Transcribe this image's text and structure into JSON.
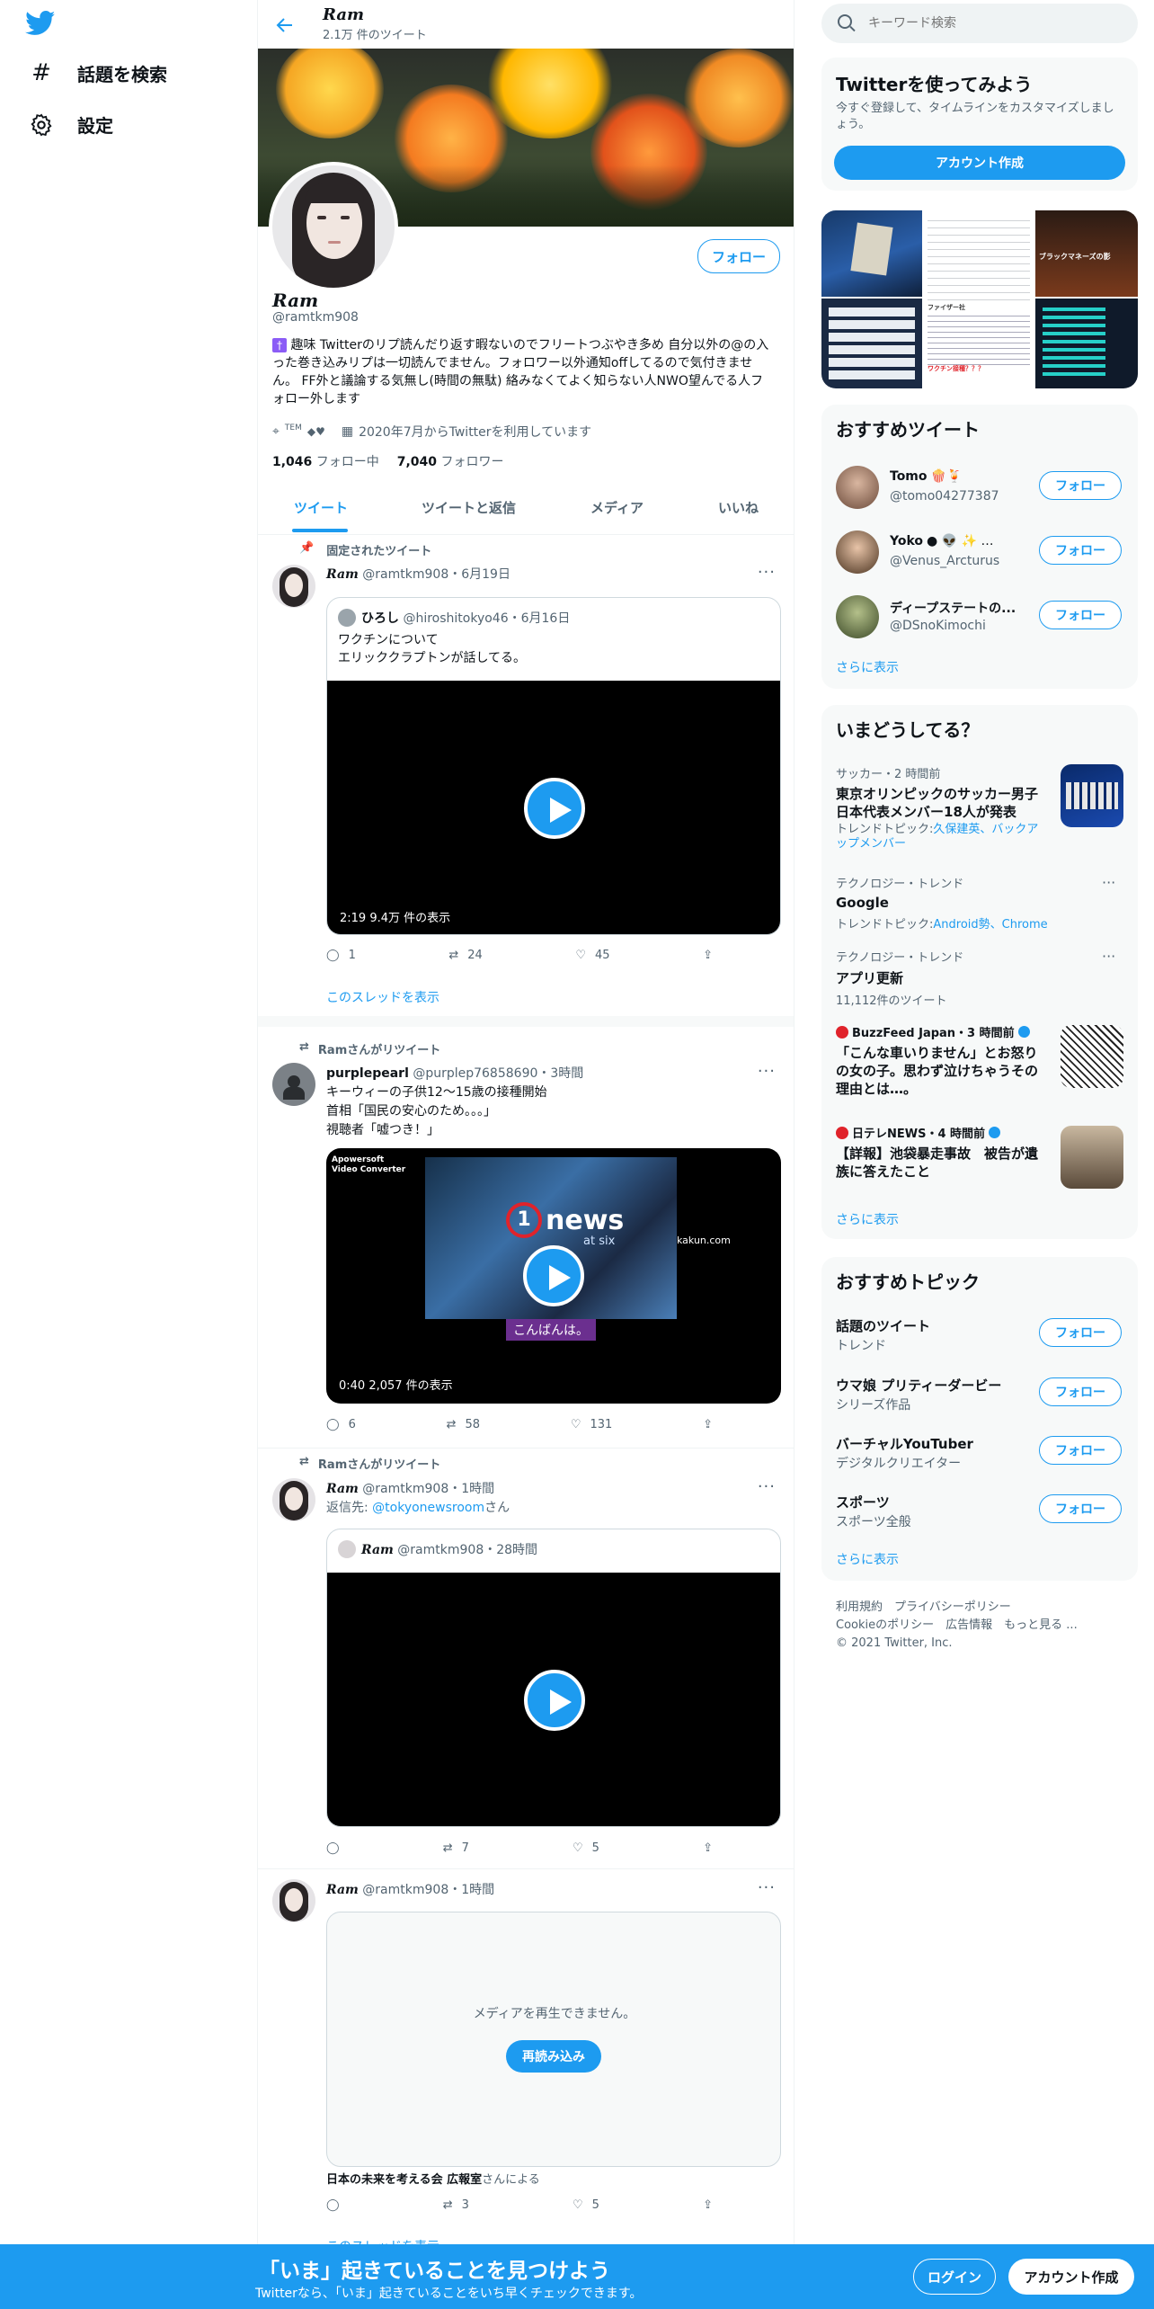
{
  "nav": {
    "search": "話題を検索",
    "settings": "設定"
  },
  "header": {
    "name": "Ram",
    "count": "2.1万 件のツイート"
  },
  "profile": {
    "name": "Ram",
    "handle": "@ramtkm908",
    "follow": "フォロー",
    "bio": "趣味 Twitterのリプ読んだり返す暇ないのでフリートつぶやき多め 自分以外の@の入った巻き込みリプは一切読んでません。フォロワー以外通知offしてるので気付きません。 FF外と議論する気無し(時間の無駄) 絡みなくてよく知らない人NWO望んでる人フォロー外します",
    "location": "TEM",
    "joined": "2020年7月からTwitterを利用しています",
    "following_n": "1,046",
    "following": "フォロー中",
    "followers_n": "7,040",
    "followers": "フォロワー"
  },
  "tabs": [
    "ツイート",
    "ツイートと返信",
    "メディア",
    "いいね"
  ],
  "t1": {
    "pinned": "固定されたツイート",
    "name": "Ram",
    "meta": "@ramtkm908・6月19日",
    "qname": "ひろし",
    "qmeta": "@hiroshitokyo46・6月16日",
    "qtext1": "ワクチンについて",
    "qtext2": "エリッククラプトンが話してる。",
    "vlabel": "2:19 9.4万 件の表示",
    "reply": "1",
    "rt": "24",
    "like": "45",
    "thread": "このスレッドを表示"
  },
  "t2": {
    "rtby": "Ramさんがリツイート",
    "name": "purplepearl",
    "meta": "@purplep76858690・3時間",
    "line1": "キーウィーの子供12～15歳の接種開始",
    "line2": "首相「国民の安心のため。。。」",
    "line3": "視聴者「嘘つき！」",
    "wm1": "Apowersoft",
    "wm2": "Video Converter",
    "news": "news",
    "newssub": "at six",
    "site": "kakun.com",
    "caption": "こんばんは。",
    "vlabel": "0:40 2,057 件の表示",
    "reply": "6",
    "rt": "58",
    "like": "131"
  },
  "t3": {
    "rtby": "Ramさんがリツイート",
    "name": "Ram",
    "meta": "@ramtkm908・1時間",
    "replyto": "返信先:",
    "replyhandle": "@tokyonewsroom",
    "replysuffix": "さん",
    "qname": "Ram",
    "qmeta": "@ramtkm908・28時間",
    "rt": "7",
    "like": "5"
  },
  "t4": {
    "name": "Ram",
    "meta": "@ramtkm908・1時間",
    "error": "メディアを再生できません。",
    "retry": "再読み込み",
    "by": "日本の未来を考える会 広報室",
    "bysuffix": "さんによる",
    "rt": "3",
    "like": "5",
    "thread": "このスレッドを表示"
  },
  "right": {
    "search": "キーワード検索",
    "try": {
      "title": "Twitterを使ってみよう",
      "desc": "今すぐ登録して、タイムラインをカスタマイズしましょう。",
      "btn": "アカウント作成"
    },
    "media": {
      "m2a": "ファイザー社",
      "m2b": "ワクチン接種？？？",
      "m3": "ブラックマネーズの影"
    },
    "rec": {
      "title": "おすすめツイート",
      "users": [
        {
          "name": "Tomo",
          "handle": "@tomo04277387"
        },
        {
          "name": "Yoko",
          "handle": "@Venus_Arcturus"
        },
        {
          "name": "ディープステートの...",
          "handle": "@DSnoKimochi"
        }
      ],
      "follow": "フォロー",
      "more": "さらに表示"
    },
    "trends": {
      "title": "いまどうしてる？",
      "items": [
        {
          "cat": "サッカー・2 時間前",
          "title": "東京オリンピックのサッカー男子日本代表メンバー18人が発表",
          "sub": "トレンドトピック:",
          "links": "久保建英、バックアップメンバー"
        },
        {
          "cat": "テクノロジー・トレンド",
          "title": "Google",
          "sub": "トレンドトピック:",
          "links": "Android勢、Chrome"
        },
        {
          "cat": "テクノロジー・トレンド",
          "title": "アプリ更新",
          "sub": "11,112件のツイート",
          "links": ""
        },
        {
          "cat": "BuzzFeed Japan・3 時間前",
          "title": "「こんな車いりません」とお怒りの女の子。思わず泣けちゃうその理由とは…。",
          "sub": "",
          "links": ""
        },
        {
          "cat": "日テレNEWS・4 時間前",
          "title": "【詳報】池袋暴走事故　被告が遺族に答えたこと",
          "sub": "",
          "links": ""
        }
      ],
      "more": "さらに表示"
    },
    "topics": {
      "title": "おすすめトピック",
      "items": [
        {
          "name": "話題のツイート",
          "sub": "トレンド"
        },
        {
          "name": "ウマ娘 プリティーダービー",
          "sub": "シリーズ作品"
        },
        {
          "name": "バーチャルYouTuber",
          "sub": "デジタルクリエイター"
        },
        {
          "name": "スポーツ",
          "sub": "スポーツ全般"
        }
      ],
      "follow": "フォロー",
      "more": "さらに表示"
    },
    "footer": {
      "l1": "利用規約",
      "l2": "プライバシーポリシー",
      "l3": "Cookieのポリシー",
      "l4": "広告情報",
      "l5": "もっと見る ...",
      "copy": "© 2021 Twitter, Inc."
    }
  },
  "bottom": {
    "title": "「いま」起きていることを見つけよう",
    "sub": "Twitterなら、「いま」起きていることをいち早くチェックできます。",
    "login": "ログイン",
    "signup": "アカウント作成"
  },
  "colors": {
    "accent": "#1d9bf0",
    "text": "#0f1419",
    "muted": "#536471"
  }
}
